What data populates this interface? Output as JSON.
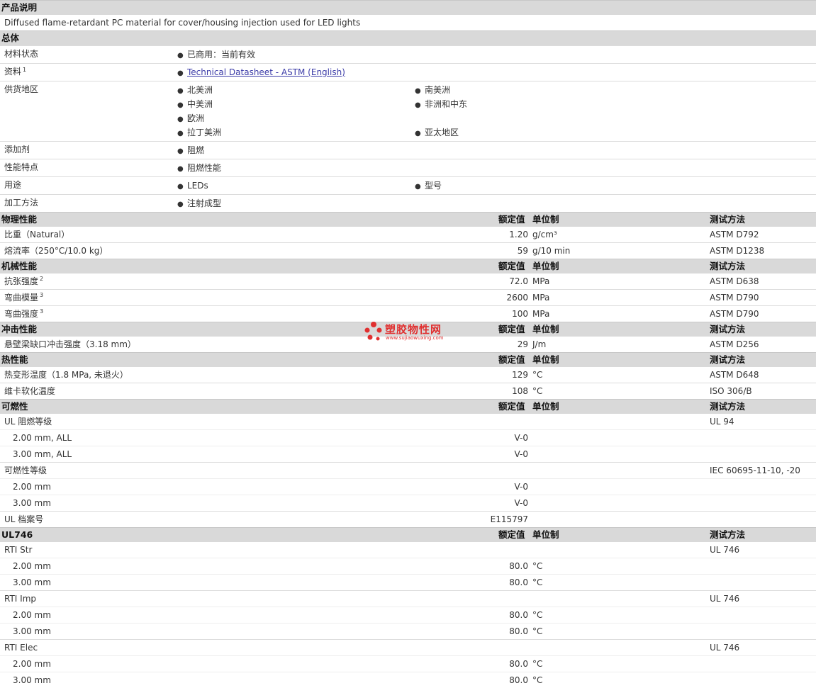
{
  "intro": {
    "header": "产品说明",
    "description": "Diffused flame-retardant PC material for cover/housing injection used for LED lights"
  },
  "general": {
    "header": "总体",
    "rows": [
      {
        "label": "材料状态",
        "items": [
          "已商用：当前有效"
        ]
      },
      {
        "label": "资料",
        "sup": "1",
        "items": [
          "Technical Datasheet - ASTM (English)"
        ],
        "link": true
      },
      {
        "label": "供货地区",
        "items": [
          "北美洲",
          "南美洲",
          "中美洲",
          "非洲和中东",
          "欧洲",
          "",
          "拉丁美洲",
          "亚太地区"
        ]
      },
      {
        "label": "添加剂",
        "items": [
          "阻燃"
        ]
      },
      {
        "label": "性能特点",
        "items": [
          "阻燃性能"
        ]
      },
      {
        "label": "用途",
        "items": [
          "LEDs",
          "型号"
        ]
      },
      {
        "label": "加工方法",
        "items": [
          "注射成型"
        ]
      }
    ]
  },
  "column_headers": {
    "value": "额定值",
    "unit": "单位制",
    "method": "测试方法"
  },
  "sections": [
    {
      "title": "物理性能",
      "rows": [
        {
          "label": "比重（Natural）",
          "value": "1.20",
          "unit": "g/cm³",
          "method": "ASTM D792"
        },
        {
          "label": "熔流率（250°C/10.0 kg）",
          "value": "59",
          "unit": "g/10 min",
          "method": "ASTM D1238"
        }
      ]
    },
    {
      "title": "机械性能",
      "rows": [
        {
          "label": "抗张强度",
          "sup": "2",
          "value": "72.0",
          "unit": "MPa",
          "method": "ASTM D638"
        },
        {
          "label": "弯曲模量",
          "sup": "3",
          "value": "2600",
          "unit": "MPa",
          "method": "ASTM D790"
        },
        {
          "label": "弯曲强度",
          "sup": "3",
          "value": "100",
          "unit": "MPa",
          "method": "ASTM D790"
        }
      ]
    },
    {
      "title": "冲击性能",
      "rows": [
        {
          "label": "悬壁梁缺口冲击强度（3.18 mm）",
          "value": "29",
          "unit": "J/m",
          "method": "ASTM D256"
        }
      ]
    },
    {
      "title": "热性能",
      "rows": [
        {
          "label": "热变形温度（1.8 MPa, 未退火）",
          "value": "129",
          "unit": "°C",
          "method": "ASTM D648"
        },
        {
          "label": "维卡软化温度",
          "value": "108",
          "unit": "°C",
          "method": "ISO 306/B"
        }
      ]
    },
    {
      "title": "可燃性",
      "rows": [
        {
          "label": "UL 阻燃等级",
          "value": "",
          "unit": "",
          "method": "UL 94"
        },
        {
          "label": "2.00 mm, ALL",
          "indent": true,
          "value": "V-0",
          "unit": "",
          "method": ""
        },
        {
          "label": "3.00 mm, ALL",
          "indent": true,
          "value": "V-0",
          "unit": "",
          "method": ""
        },
        {
          "label": "可燃性等级",
          "value": "",
          "unit": "",
          "method": "IEC 60695-11-10, -20"
        },
        {
          "label": "2.00 mm",
          "indent": true,
          "value": "V-0",
          "unit": "",
          "method": ""
        },
        {
          "label": "3.00 mm",
          "indent": true,
          "value": "V-0",
          "unit": "",
          "method": ""
        },
        {
          "label": "UL 档案号",
          "value": "E115797",
          "unit": "",
          "method": ""
        }
      ]
    },
    {
      "title": "UL746",
      "rows": [
        {
          "label": "RTI Str",
          "value": "",
          "unit": "",
          "method": "UL 746"
        },
        {
          "label": "2.00 mm",
          "indent": true,
          "value": "80.0",
          "unit": "°C",
          "method": ""
        },
        {
          "label": "3.00 mm",
          "indent": true,
          "value": "80.0",
          "unit": "°C",
          "method": ""
        },
        {
          "label": "RTI Imp",
          "value": "",
          "unit": "",
          "method": "UL 746"
        },
        {
          "label": "2.00 mm",
          "indent": true,
          "value": "80.0",
          "unit": "°C",
          "method": ""
        },
        {
          "label": "3.00 mm",
          "indent": true,
          "value": "80.0",
          "unit": "°C",
          "method": ""
        },
        {
          "label": "RTI Elec",
          "value": "",
          "unit": "",
          "method": "UL 746"
        },
        {
          "label": "2.00 mm",
          "indent": true,
          "value": "80.0",
          "unit": "°C",
          "method": ""
        },
        {
          "label": "3.00 mm",
          "indent": true,
          "value": "80.0",
          "unit": "°C",
          "method": ""
        }
      ]
    }
  ],
  "watermark": {
    "name": "塑胶物性网",
    "url": "www.sujiaowuxing.com",
    "color": "#e03030"
  }
}
